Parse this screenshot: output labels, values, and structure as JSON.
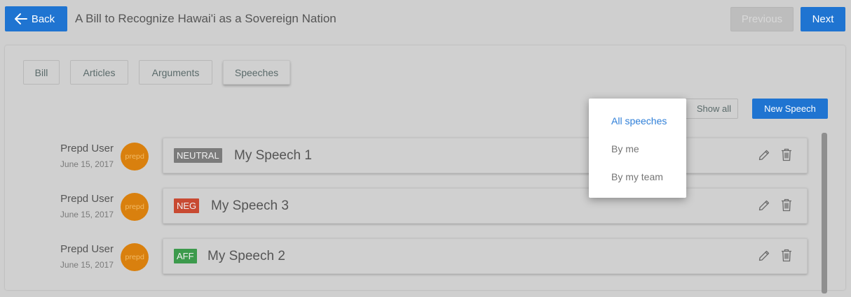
{
  "header": {
    "back_label": "Back",
    "title": "A Bill to Recognize Hawai'i as a Sovereign Nation",
    "previous_label": "Previous",
    "next_label": "Next"
  },
  "tabs": [
    {
      "label": "Bill"
    },
    {
      "label": "Articles"
    },
    {
      "label": "Arguments"
    },
    {
      "label": "Speeches"
    }
  ],
  "toolbar": {
    "show_all_label": "Show all",
    "new_speech_label": "New Speech"
  },
  "filter_menu": {
    "items": [
      "All speeches",
      "By me",
      "By my team"
    ],
    "selected": "All speeches"
  },
  "speeches": [
    {
      "author": "Prepd User",
      "date": "June 15, 2017",
      "avatar_text": "prepd",
      "badge": "NEUTRAL",
      "badge_color": "#7b7b7b",
      "title": "My Speech 1"
    },
    {
      "author": "Prepd User",
      "date": "June 15, 2017",
      "avatar_text": "prepd",
      "badge": "NEG",
      "badge_color": "#c84a32",
      "title": "My Speech 3"
    },
    {
      "author": "Prepd User",
      "date": "June 15, 2017",
      "avatar_text": "prepd",
      "badge": "AFF",
      "badge_color": "#3c9a4c",
      "title": "My Speech 2"
    }
  ],
  "colors": {
    "primary": "#1f74d1",
    "avatar": "#d9800e",
    "menu_selected": "#2f7fd8"
  },
  "icons": {
    "back": "arrow-left-icon",
    "edit": "pencil-icon",
    "delete": "trash-icon"
  }
}
